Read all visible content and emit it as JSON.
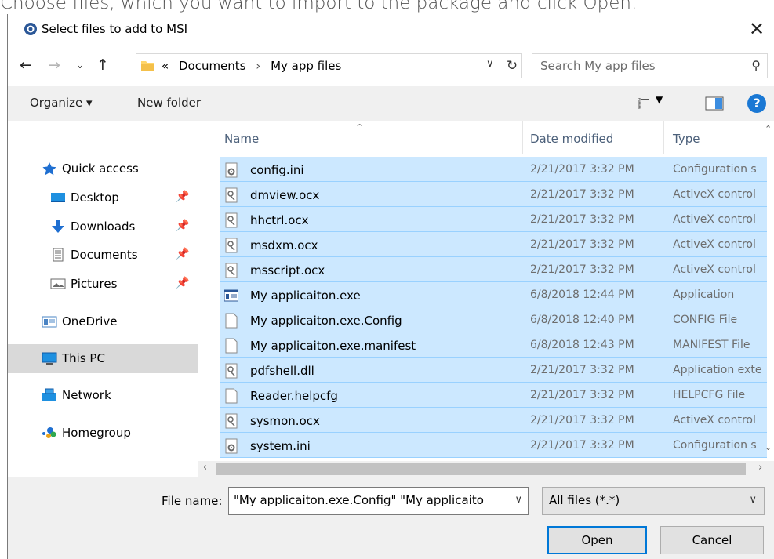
{
  "instruction_text": "Choose files, which you want to import to the package and click Open.",
  "window": {
    "title": "Select files to add to MSI",
    "close_glyph": "✕"
  },
  "nav": {
    "back_glyph": "←",
    "forward_glyph": "→",
    "recent_glyph": "⌄",
    "up_glyph": "↑",
    "breadcrumb_overflow": "«",
    "breadcrumbs": [
      "Documents",
      "My app files"
    ],
    "breadcrumb_sep": "›",
    "address_dropdown_glyph": "∨",
    "refresh_glyph": "↻",
    "search_placeholder": "Search My app files",
    "search_icon_glyph": "⚲"
  },
  "toolbar": {
    "organize_label": "Organize ▾",
    "new_folder_label": "New folder",
    "view_dropdown_glyph": "▼",
    "help_glyph": "?"
  },
  "sidebar": {
    "items": [
      {
        "label": "Quick access",
        "icon": "star-icon",
        "pinned": false
      },
      {
        "label": "Desktop",
        "icon": "desktop-icon",
        "pinned": true
      },
      {
        "label": "Downloads",
        "icon": "downloads-icon",
        "pinned": true
      },
      {
        "label": "Documents",
        "icon": "documents-icon",
        "pinned": true
      },
      {
        "label": "Pictures",
        "icon": "pictures-icon",
        "pinned": true
      },
      {
        "label": "OneDrive",
        "icon": "onedrive-icon",
        "pinned": false
      },
      {
        "label": "This PC",
        "icon": "this-pc-icon",
        "pinned": false,
        "selected": true
      },
      {
        "label": "Network",
        "icon": "network-icon",
        "pinned": false
      },
      {
        "label": "Homegroup",
        "icon": "homegroup-icon",
        "pinned": false
      }
    ],
    "pin_glyph": "📌"
  },
  "file_list": {
    "columns": [
      "Name",
      "Date modified",
      "Type"
    ],
    "sort_caret": "^",
    "rows": [
      {
        "name": "config.ini",
        "date": "2/21/2017 3:32 PM",
        "type": "Configuration s",
        "icon": "settings-file-icon",
        "selected": true
      },
      {
        "name": "dmview.ocx",
        "date": "2/21/2017 3:32 PM",
        "type": "ActiveX control",
        "icon": "activex-file-icon",
        "selected": true
      },
      {
        "name": "hhctrl.ocx",
        "date": "2/21/2017 3:32 PM",
        "type": "ActiveX control",
        "icon": "activex-file-icon",
        "selected": true
      },
      {
        "name": "msdxm.ocx",
        "date": "2/21/2017 3:32 PM",
        "type": "ActiveX control",
        "icon": "activex-file-icon",
        "selected": true
      },
      {
        "name": "msscript.ocx",
        "date": "2/21/2017 3:32 PM",
        "type": "ActiveX control",
        "icon": "activex-file-icon",
        "selected": true
      },
      {
        "name": "My applicaiton.exe",
        "date": "6/8/2018 12:44 PM",
        "type": "Application",
        "icon": "application-icon",
        "selected": true
      },
      {
        "name": "My applicaiton.exe.Config",
        "date": "6/8/2018 12:40 PM",
        "type": "CONFIG File",
        "icon": "blank-file-icon",
        "selected": true
      },
      {
        "name": "My applicaiton.exe.manifest",
        "date": "6/8/2018 12:43 PM",
        "type": "MANIFEST File",
        "icon": "blank-file-icon",
        "selected": true
      },
      {
        "name": "pdfshell.dll",
        "date": "2/21/2017 3:32 PM",
        "type": "Application exte",
        "icon": "activex-file-icon",
        "selected": true
      },
      {
        "name": "Reader.helpcfg",
        "date": "2/21/2017 3:32 PM",
        "type": "HELPCFG File",
        "icon": "blank-file-icon",
        "selected": true
      },
      {
        "name": "sysmon.ocx",
        "date": "2/21/2017 3:32 PM",
        "type": "ActiveX control",
        "icon": "activex-file-icon",
        "selected": true
      },
      {
        "name": "system.ini",
        "date": "2/21/2017 3:32 PM",
        "type": "Configuration s",
        "icon": "settings-file-icon",
        "selected": true
      }
    ]
  },
  "scroll": {
    "left_glyph": "‹",
    "right_glyph": "›",
    "vup_glyph": "⌃",
    "vdown_glyph": "⌄"
  },
  "bottom": {
    "file_name_label": "File name:",
    "file_name_value": "\"My applicaiton.exe.Config\" \"My applicaito",
    "dropdown_glyph": "∨",
    "file_type_value": "All files (*.*)",
    "open_label": "Open",
    "cancel_label": "Cancel"
  }
}
